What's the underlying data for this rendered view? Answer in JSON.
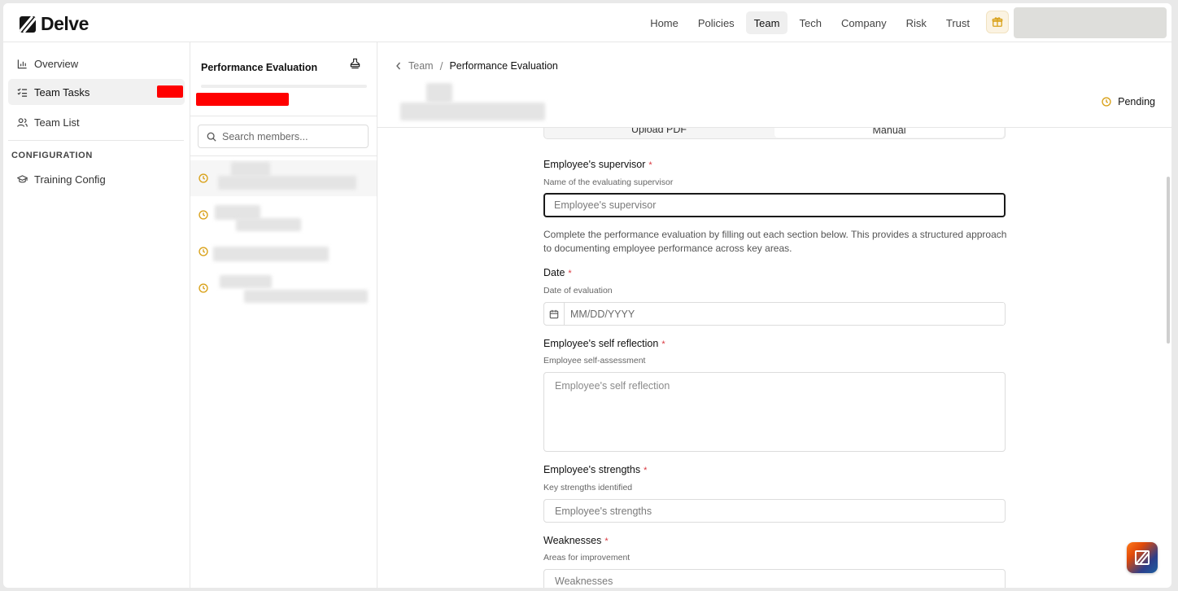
{
  "app": {
    "name": "Delve"
  },
  "nav": {
    "items": [
      {
        "label": "Home"
      },
      {
        "label": "Policies"
      },
      {
        "label": "Team",
        "active": true
      },
      {
        "label": "Tech"
      },
      {
        "label": "Company"
      },
      {
        "label": "Risk"
      },
      {
        "label": "Trust"
      }
    ]
  },
  "sidebar": {
    "items": [
      {
        "label": "Overview",
        "icon": "bar-chart-icon"
      },
      {
        "label": "Team Tasks",
        "icon": "list-checks-icon",
        "active": true
      },
      {
        "label": "Team List",
        "icon": "users-icon"
      }
    ],
    "section_title": "CONFIGURATION",
    "config_items": [
      {
        "label": "Training Config",
        "icon": "graduation-cap-icon"
      }
    ]
  },
  "middle": {
    "title": "Performance Evaluation",
    "search_placeholder": "Search members...",
    "members_count": 4
  },
  "breadcrumb": {
    "parent": "Team",
    "separator": "/",
    "current": "Performance Evaluation"
  },
  "status": {
    "label": "Pending",
    "color": "#d9a21b"
  },
  "tabs": [
    {
      "label": "Upload PDF"
    },
    {
      "label": "Manual",
      "active": true
    }
  ],
  "form": {
    "supervisor": {
      "label": "Employee's supervisor",
      "hint": "Name of the evaluating supervisor",
      "placeholder": "Employee's supervisor"
    },
    "description": "Complete the performance evaluation by filling out each section below. This provides a structured approach to documenting employee performance across key areas.",
    "date": {
      "label": "Date",
      "hint": "Date of evaluation",
      "placeholder": "MM/DD/YYYY"
    },
    "self_reflection": {
      "label": "Employee's self reflection",
      "hint": "Employee self-assessment",
      "placeholder": "Employee's self reflection"
    },
    "strengths": {
      "label": "Employee's strengths",
      "hint": "Key strengths identified",
      "placeholder": "Employee's strengths"
    },
    "weaknesses": {
      "label": "Weaknesses",
      "hint": "Areas for improvement",
      "placeholder": "Weaknesses"
    },
    "required_mark": "*"
  },
  "colors": {
    "accent": "#d9a21b",
    "required": "#d9363e",
    "redacted": "#ff0000"
  }
}
